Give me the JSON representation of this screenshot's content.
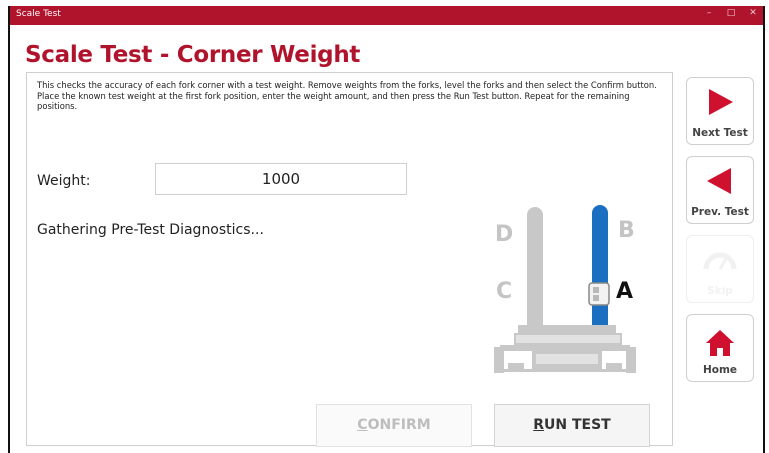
{
  "window": {
    "title": "Scale Test",
    "controls": [
      "–",
      "□",
      "✕"
    ]
  },
  "page": {
    "title": "Scale Test - Corner Weight"
  },
  "instructions": "This checks the accuracy of each fork corner with a test weight. Remove weights from the forks, level the forks and then select the Confirm button. Place the known test weight at the first fork position, enter the weight amount, and then press the Run Test button. Repeat for the remaining positions.",
  "weight": {
    "label": "Weight:",
    "value": "1000"
  },
  "status_text": "Gathering Pre-Test Diagnostics...",
  "fork_diagram": {
    "letters": {
      "a": "A",
      "b": "B",
      "c": "C",
      "d": "D"
    },
    "active_position": "A",
    "colors": {
      "active": "#1a6fc0",
      "inactive": "#c8c8c8"
    }
  },
  "buttons": {
    "confirm_access_key": "C",
    "confirm_rest": "ONFIRM",
    "run_access_key": "R",
    "run_rest": "UN TEST"
  },
  "sidebar": {
    "next_label": "Next Test",
    "prev_label": "Prev. Test",
    "disabled_label": "Skip",
    "home_label": "Home"
  },
  "colors": {
    "brand": "#b0142c",
    "icon_red": "#d0102f",
    "fork_blue": "#1a6fc0"
  }
}
